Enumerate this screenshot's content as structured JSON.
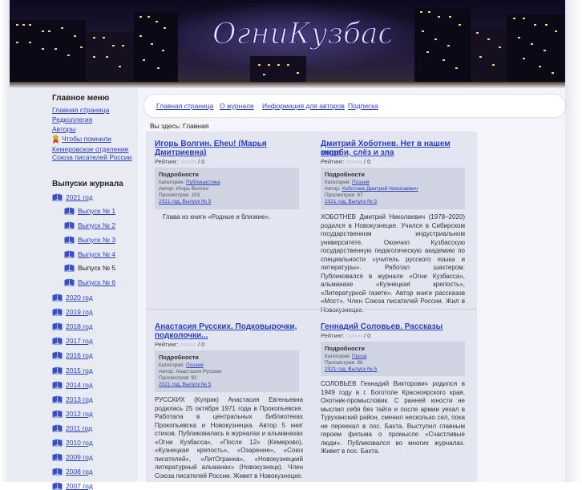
{
  "site": {
    "logo_text": "ОгниКузбасса"
  },
  "sidebar": {
    "menu_title": "Главное меню",
    "menu_items": [
      {
        "label": "Главная страница"
      },
      {
        "label": "Редколлегия"
      },
      {
        "label": "Авторы"
      },
      {
        "label": "Чтобы помнили"
      },
      {
        "label": "Кемеровское отделение"
      },
      {
        "label": "Союза писателей России"
      }
    ],
    "issues_title": "Выпуски журнала",
    "year_2021": "2021 год",
    "issues_2021": [
      {
        "label": "Выпуск № 1"
      },
      {
        "label": "Выпуск № 2"
      },
      {
        "label": "Выпуск № 3"
      },
      {
        "label": "Выпуск № 4"
      },
      {
        "label": "Выпуск № 5"
      },
      {
        "label": "Выпуск № 6"
      }
    ],
    "years": [
      {
        "label": "2020 год"
      },
      {
        "label": "2019 год"
      },
      {
        "label": "2018 год"
      },
      {
        "label": "2017 год"
      },
      {
        "label": "2016 год"
      },
      {
        "label": "2015 год"
      },
      {
        "label": "2014 год"
      },
      {
        "label": "2013 год"
      },
      {
        "label": "2012 год"
      },
      {
        "label": "2011 год"
      },
      {
        "label": "2010 год"
      },
      {
        "label": "2009 год"
      },
      {
        "label": "2008 год"
      },
      {
        "label": "2007 год"
      }
    ]
  },
  "nav": {
    "items": [
      {
        "label": "Главная страница"
      },
      {
        "label": "О журнале"
      },
      {
        "label": "Информация для авторов"
      },
      {
        "label": "Подписка"
      }
    ]
  },
  "breadcrumb": "Вы здесь: Главная",
  "details_label": "Подробности",
  "articles": [
    {
      "title1": "Игорь Волгин. Eheu! (Марья",
      "title2": "Дмитриевна)",
      "rating": "Рейтинг:",
      "rating_value": "/ 0",
      "category_prefix": "Категория:",
      "category": "Публицистика",
      "author": "Автор: Игорь Волгин",
      "views": "Просмотров: 103",
      "issue": "2021 год, Выпуск № 5",
      "text": "Глава из книги «Родные и близкие»."
    },
    {
      "title1": "Дмитрий Хоботнев. Нет в нашем мире",
      "title2": "скорби, слёз и зла",
      "rating": "Рейтинг:",
      "rating_value": "/ 0",
      "category_prefix": "Категория:",
      "category": "Поэзия",
      "author_prefix": "Автор:",
      "author": "Хоботнев Дмитрий Николаевич",
      "views": "Просмотров: 87",
      "issue": "2021 год, Выпуск № 5",
      "text": "ХОБОТНЕВ Дмитрий Николаевич (1978–2020) родился в Новокузнецке. Учился в Сибирском государственном индустриальном университете. Окончил Кузбасскую государственную педагогическую академию по специальности «учитель русского языка и литературы». Работал шахтером. Публиковался в журнале «Огни Кузбасса», альманахе «Кузнецкая крепость», «Литературной газете». Автор книги рассказов «Мост». Член Союза писателей России. Жил в Новокузнецке."
    },
    {
      "title1": "Анастасия Русских. Подковырочки,",
      "title2": "подколочки...",
      "rating": "Рейтинг:",
      "rating_value": "/ 0",
      "category_prefix": "Категория:",
      "category": "Поэзия",
      "author": "Автор: Анастасия Русских",
      "views": "Просмотров: 92",
      "issue": "2021 год, Выпуск № 5",
      "text": "РУССКИХ (Куприк) Анастасия Евгеньевна родилась 25 октября 1971 года в Прокопьевске. Работала в центральных библиотеках Прокопьевска и Новокузнецка. Автор 5 книг стихов. Публиковалась в журналах и альманахах «Огни Кузбасса», «После 12» (Кемерово), «Кузнецкая крепость», «Озарение», «Союз писателей», «ЛитОгранка», «Новокузнецкий литературный альманах» (Новокузнецк). Член Союза писателей России. Живет в Новокузнецке."
    },
    {
      "title1": "Геннадий Соловьев. Рассказы",
      "rating": "Рейтинг:",
      "rating_value": "/ 0",
      "category_prefix": "Категория:",
      "category": "Проза",
      "views": "Просмотров: 86",
      "issue": "2021 год, Выпуск № 5",
      "text": "СОЛОВЬЕВ Геннадий Викторович родился в 1949 году в г. Боготоле Красноярского края. Охотник-промысловик. С ранней юности не мыслил себя без тайги и после армии уехал в Туруханский район, сменил несколько сел, пока не переехал в пос. Бахта. Выступил главным героем фильма о промысле «Счастливые люди». Публиковался во многих журналах. Живет в пос. Бахта."
    }
  ],
  "colors": {
    "link": "#2a3fb8",
    "sidebar_bg": "#e9ebf3",
    "content_bg": "#e3e6f1",
    "details_bg": "#d0d3e2",
    "book_icon": "#3a4fc4"
  }
}
